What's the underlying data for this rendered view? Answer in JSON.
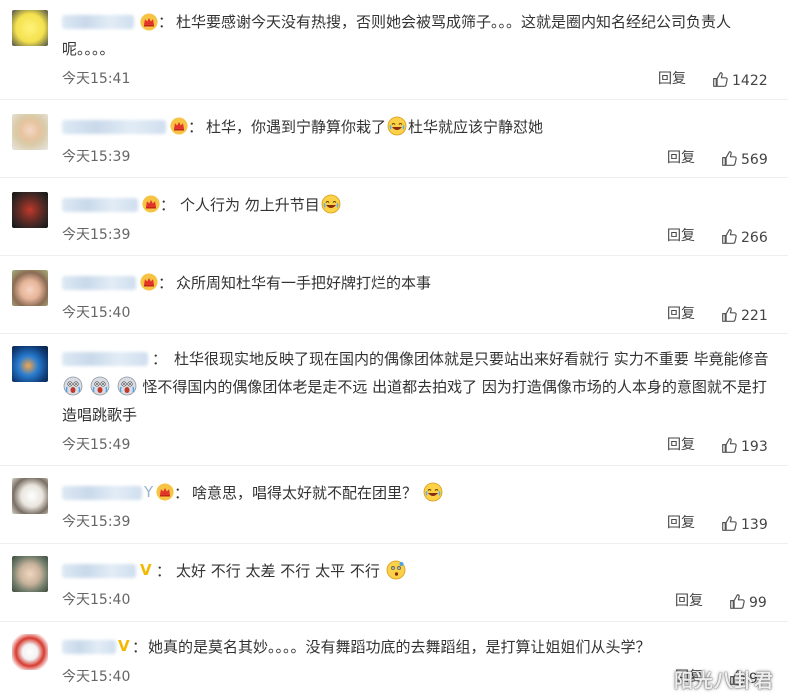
{
  "comments": [
    {
      "line1": "杜华要感谢今天没有热搜，否则她会被骂成筛子。。。这就是圈内知名经纪公司负责人",
      "line2": "呢。。。。",
      "time": "今天15:41",
      "reply": "回复",
      "likes": "1422"
    },
    {
      "text_a": "杜华，你遇到宁静算你栽了",
      "text_b": "杜华就应该宁静怼她",
      "time": "今天15:39",
      "reply": "回复",
      "likes": "569"
    },
    {
      "text_a": "个人行为 勿上升节目",
      "time": "今天15:39",
      "reply": "回复",
      "likes": "266"
    },
    {
      "text_a": "众所周知杜华有一手把好牌打烂的本事",
      "time": "今天15:40",
      "reply": "回复",
      "likes": "221"
    },
    {
      "line1": "杜华很现实地反映了现在国内的偶像团体就是只要站出来好看就行 实力不重要 毕竟能修音",
      "line2": "怪不得国内的偶像团体老是走不远 出道都去拍戏了 因为打造偶像市场的人本身的意图就不是打",
      "line3": "造唱跳歌手",
      "time": "今天15:49",
      "reply": "回复",
      "likes": "193"
    },
    {
      "text_a": "啥意思，唱得太好就不配在团里？",
      "time": "今天15:39",
      "reply": "回复",
      "likes": "139"
    },
    {
      "text_a": "太好 不行 太差 不行 太平 不行",
      "time": "今天15:40",
      "reply": "回复",
      "likes": "99"
    },
    {
      "text_a": "她真的是莫名其妙。。。。没有舞蹈功底的去舞蹈组，是打算让姐姐们从头学？",
      "time": "今天15:40",
      "reply": "回复",
      "likes": "9"
    }
  ],
  "colon": "：",
  "badge_v": "V",
  "username_hint": "Y",
  "watermark": "阳光八卦君",
  "colors": {
    "accent_gold": "#f5b800",
    "badge_red": "#e2332b",
    "text": "#333333",
    "meta": "#666666",
    "divider": "#eeeeee"
  },
  "icons": [
    "vip-crown-icon",
    "thumbs-up-icon",
    "laugh-cry-emoji",
    "tears-of-joy-emoji",
    "shocked-emoji",
    "thinking-emoji"
  ]
}
